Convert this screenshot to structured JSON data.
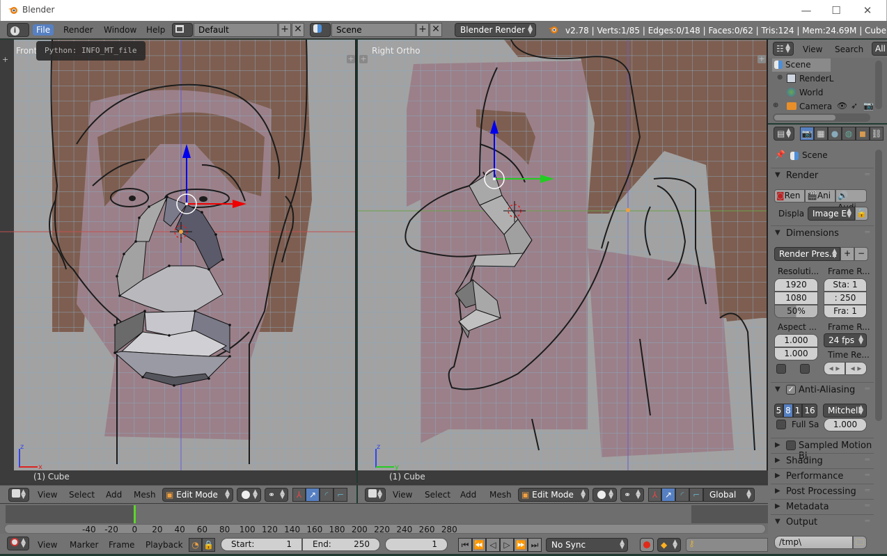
{
  "window": {
    "title": "Blender",
    "controls": {
      "minimize": "—",
      "maximize": "☐",
      "close": "✕"
    }
  },
  "info_header": {
    "menus": [
      "File",
      "Render",
      "Window",
      "Help"
    ],
    "active_menu": "File",
    "screen_layout": "Default",
    "scene": "Scene",
    "render_engine": "Blender Render",
    "stats": "v2.78 | Verts:1/85 | Edges:0/148 | Faces:0/62 | Tris:124 | Mem:24.69M | Cube"
  },
  "tooltip": "Python: INFO_MT_file",
  "viewport_left": {
    "label": "Front",
    "status": "(1) Cube",
    "axis_labels": [
      "z",
      "x"
    ]
  },
  "viewport_right": {
    "label": "Right Ortho",
    "status": "(1) Cube",
    "axis_labels": [
      "z",
      "y"
    ]
  },
  "view3d_header_left": {
    "menus": [
      "View",
      "Select",
      "Add",
      "Mesh"
    ],
    "mode": "Edit Mode"
  },
  "view3d_header_right": {
    "menus": [
      "View",
      "Select",
      "Add",
      "Mesh"
    ],
    "mode": "Edit Mode",
    "orientation": "Global"
  },
  "outliner": {
    "menus": [
      "View",
      "Search"
    ],
    "filter": "All",
    "items": [
      {
        "label": "Scene",
        "icon": "scene-icon"
      },
      {
        "label": "RenderL",
        "icon": "render-layers-icon"
      },
      {
        "label": "World",
        "icon": "world-icon"
      },
      {
        "label": "Camera",
        "icon": "camera-icon"
      }
    ]
  },
  "properties": {
    "context": "Scene",
    "render": {
      "title": "Render",
      "buttons": [
        "Ren",
        "Ani",
        "Audi"
      ],
      "display_label": "Displa",
      "display_value": "Image E"
    },
    "dimensions": {
      "title": "Dimensions",
      "preset": "Render Pres...",
      "resolution_label": "Resoluti...",
      "res_x": "1920",
      "res_y": "1080",
      "res_pct": "50%",
      "frame_range_label": "Frame R...",
      "start": "Sta: 1",
      "end": ": 250",
      "frame_step": "Fra: 1",
      "aspect_label": "Aspect ...",
      "aspect_x": "1.000",
      "aspect_y": "1.000",
      "frame_rate_label": "Frame R...",
      "fps": "24 fps",
      "time_remap_label": "Time Re..."
    },
    "anti_aliasing": {
      "title": "Anti-Aliasing",
      "samples": [
        "5",
        "8",
        "1",
        "16"
      ],
      "selected_sample": "8",
      "filter": "Mitchell",
      "full_sample_label": "Full Sa",
      "filter_size": "1.000"
    },
    "collapsed_panels": [
      "Sampled Motion Bl",
      "Shading",
      "Performance",
      "Post Processing",
      "Metadata"
    ],
    "output": {
      "title": "Output",
      "path": "/tmp\\"
    }
  },
  "timeline": {
    "ticks": [
      "-40",
      "-20",
      "0",
      "20",
      "40",
      "60",
      "80",
      "100",
      "120",
      "140",
      "160",
      "180",
      "200",
      "220",
      "240",
      "260",
      "280"
    ],
    "current_frame_marker": "0",
    "menus": [
      "View",
      "Marker",
      "Frame",
      "Playback"
    ],
    "start_label": "Start:",
    "start_value": "1",
    "end_label": "End:",
    "end_value": "250",
    "current_frame": "1",
    "sync": "No Sync"
  }
}
